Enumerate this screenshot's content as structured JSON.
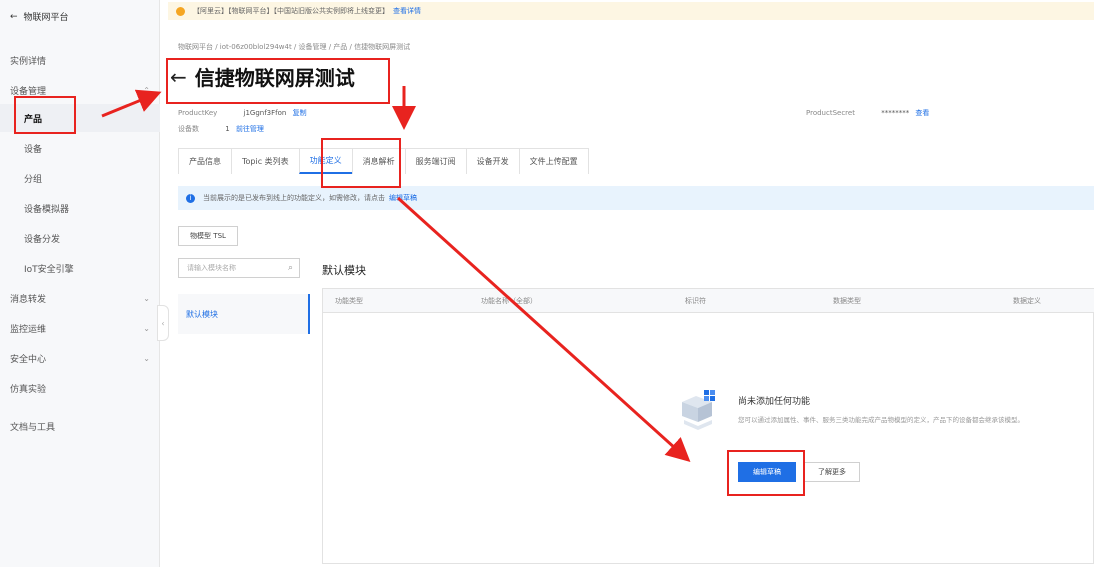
{
  "sidebar": {
    "back_label": "物联网平台",
    "items": [
      {
        "label": "实例详情",
        "chevron": ""
      },
      {
        "label": "设备管理",
        "chevron": "^"
      },
      {
        "label": "产品",
        "chevron": ""
      },
      {
        "label": "设备",
        "chevron": ""
      },
      {
        "label": "分组",
        "chevron": ""
      },
      {
        "label": "设备模拟器",
        "chevron": ""
      },
      {
        "label": "设备分发",
        "chevron": ""
      },
      {
        "label": "IoT安全引擎",
        "chevron": ""
      },
      {
        "label": "消息转发",
        "chevron": "v"
      },
      {
        "label": "监控运维",
        "chevron": "v"
      },
      {
        "label": "安全中心",
        "chevron": "v"
      },
      {
        "label": "仿真实验",
        "chevron": ""
      },
      {
        "label": "文档与工具",
        "chevron": ""
      }
    ]
  },
  "notice": {
    "text": "【阿里云】【物联网平台】【中国站旧版公共实例即将上线变更】",
    "link": "查看详情"
  },
  "breadcrumb": "物联网平台 / iot-06z00blol294w4t / 设备管理 / 产品 / 信捷物联网屏测试",
  "title": "信捷物联网屏测试",
  "product_key": {
    "label": "ProductKey",
    "value": "j1Ggnf3Ffon",
    "action": "复制"
  },
  "device_count": {
    "label": "设备数",
    "value": "1",
    "action": "前往管理"
  },
  "product_secret": {
    "label": "ProductSecret",
    "value": "********",
    "action": "查看"
  },
  "tabs": [
    "产品信息",
    "Topic 类列表",
    "功能定义",
    "消息解析",
    "服务端订阅",
    "设备开发",
    "文件上传配置"
  ],
  "active_tab": 2,
  "info": {
    "text": "当前展示的是已发布到线上的功能定义，如需修改，请点击",
    "link": "编辑草稿"
  },
  "tsl_button": "物模型 TSL",
  "search": {
    "placeholder": "请输入模块名称"
  },
  "module_title": "默认模块",
  "modules": [
    "默认模块"
  ],
  "table_headers": [
    "功能类型",
    "功能名称（全部）",
    "标识符",
    "数据类型",
    "数据定义"
  ],
  "empty": {
    "title": "尚未添加任何功能",
    "desc": "您可以通过添加属性、事件、服务三类功能完成产品物模型的定义，产品下的设备都会继承该模型。",
    "primary_button": "编辑草稿",
    "secondary_button": "了解更多"
  },
  "colors": {
    "accent": "#1f6fe5",
    "annotation": "#e8231f",
    "notice_bg": "#fdf6e3",
    "info_bg": "#e8f3fd"
  }
}
